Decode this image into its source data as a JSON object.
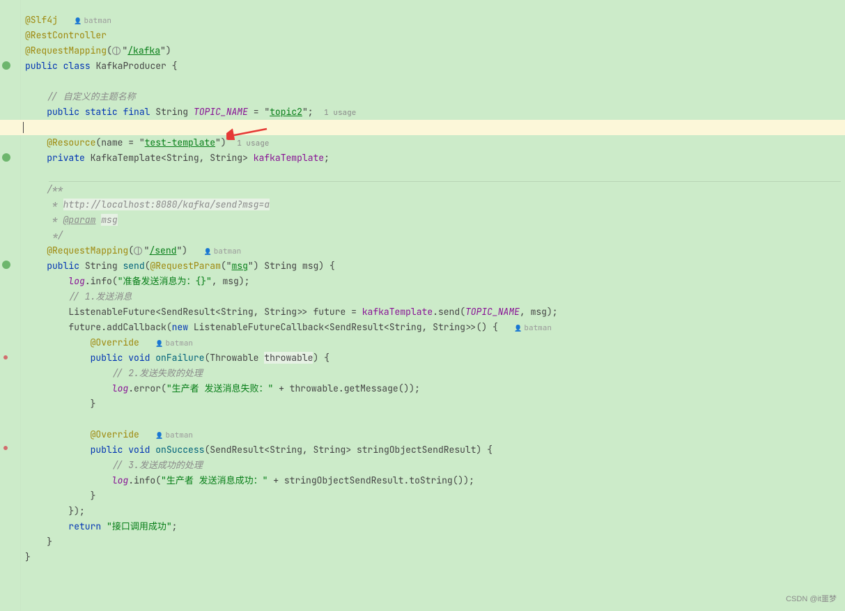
{
  "annotations": {
    "slf4j": "@Slf4j",
    "restController": "@RestController",
    "requestMapping": "@RequestMapping",
    "resource": "@Resource",
    "override": "@Override",
    "requestParam": "@RequestParam"
  },
  "strings": {
    "kafka": "/kafka",
    "topic2": "topic2",
    "resourceName": "test-template",
    "send": "/send",
    "msg": "msg",
    "prepMsg": "\"准备发送消息为：{}\"",
    "failMsg": "\"生产者 发送消息失败：\"",
    "succMsg": "\"生产者 发送消息成功：\"",
    "retMsg": "\"接口调用成功\""
  },
  "keywords": {
    "public": "public",
    "class": "class",
    "static": "static",
    "final": "final",
    "private": "private",
    "void": "void",
    "new": "new",
    "return": "return"
  },
  "identifiers": {
    "KafkaProducer": "KafkaProducer",
    "String": "String",
    "TOPIC_NAME": "TOPIC_NAME",
    "KafkaTemplate": "KafkaTemplate",
    "kafkaTemplate": "kafkaTemplate",
    "send": "send",
    "log": "log",
    "ListenableFuture": "ListenableFuture",
    "SendResult": "SendResult",
    "future": "future",
    "addCallback": "addCallback",
    "ListenableFutureCallback": "ListenableFutureCallback",
    "onFailure": "onFailure",
    "Throwable": "Throwable",
    "throwable": "throwable",
    "getMessage": "getMessage",
    "onSuccess": "onSuccess",
    "stringObjectSendResult": "stringObjectSendResult",
    "toString": "toString",
    "name": "name",
    "info": "info",
    "error": "error",
    "msg": "msg"
  },
  "comments": {
    "topicName": "// 自定义的主题名称",
    "sendMsg": "// 1.发送消息",
    "failHandle": "// 2.发送失败的处理",
    "succHandle": "// 3.发送成功的处理"
  },
  "javadoc": {
    "open": "/**",
    "url": "http://localhost:8080/kafka/send?msg=a",
    "param": "@param",
    "paramName": "msg",
    "star": " * ",
    "close": " */"
  },
  "inlays": {
    "usage1": "1 usage",
    "usage2": "1 usage"
  },
  "authors": {
    "batman": "batman"
  },
  "watermark": "CSDN @it噩梦"
}
